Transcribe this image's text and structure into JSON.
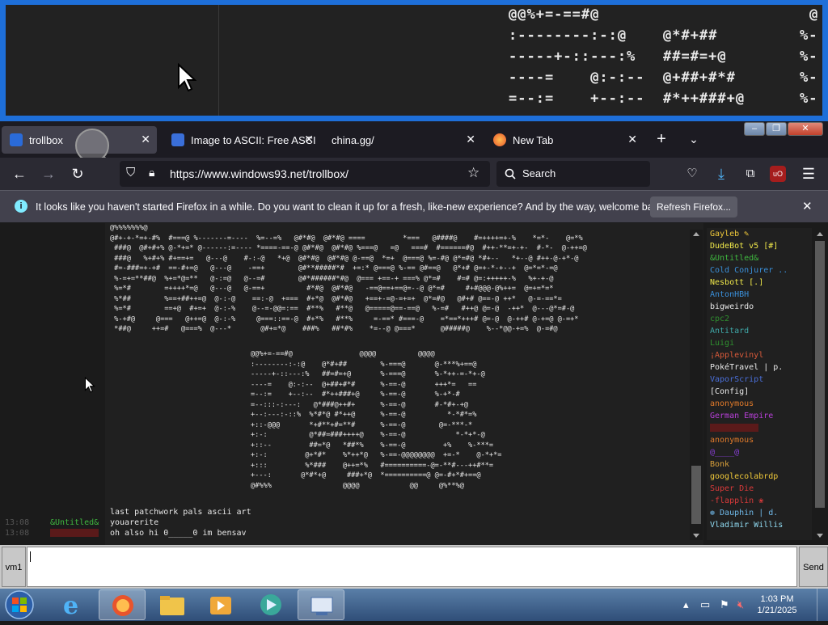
{
  "zoom": {
    "lines": [
      "@@%+=-==#@",
      ":--------:-:@    @*#+##",
      "-----+-::---:%   ##=#=+@",
      "----=    @:-:--  @+##+#*#",
      "=--:=    +--:--  #*++###+@"
    ],
    "right_lines": [
      "@",
      "%-",
      "%-",
      "%-",
      "%-"
    ]
  },
  "tabs": [
    {
      "label": "trollbox",
      "active": true
    },
    {
      "label": "Image to ASCII: Free ASCI",
      "active": false
    },
    {
      "label": "china.gg/",
      "active": false
    },
    {
      "label": "New Tab",
      "active": false
    }
  ],
  "nav": {
    "url": "https://www.windows93.net/trollbox/",
    "search_placeholder": "Search"
  },
  "notification": {
    "text": "It looks like you haven't started Firefox in a while. Do you want to clean it up for a fresh, like-new experience? And by the way, welcome back!",
    "button": "Refresh Firefox..."
  },
  "ascii_art": {
    "top_block": [
      "@%%%%%%%@",
      "@#+-+-*=+-#%  #===@ %-------=----  %=--=%   @#*#@  @#*#@ ====         *===   @####@    #=++++=+-%    *=*-    @=*%",
      " ###@  @#+#+% @-*+=* @------:=---- *====-==-@ @#*#@  @#*#@ %===@   =@   ===#  #======#@  #++-**=+-+-  #-*-  @-++=@",
      " ###@   %+#+% #+==+=   @---@    #-:-@   *+@  @#*#@  @#*#@ @-==@  *=+  @===@ %=-#@ @*=#@ *#+--   *+--@ #++-@-+*-@",
      " #=-###=+-+#  ==-#+=@   @---@    -==+        @#**#####*#  +=:* @===@ %-== @#==@   @*+# @=+-*-+--+  @=*=*-=@",
      " %-=+=**##@  %+=*@=**   @-:=@   @--=#        @#*######*#@  @=== +==-+ ===% @*=#    #=# @=:+++++-%   %+-+-@",
      " %=*#        =++++*=@   @---@   @-==+          #*#@  @#*#@   -==@==+==@=--@ @*=#     #+#@@@-@%++=  @=+=*=*",
      " %*##        %==+##++=@  @-:-@    ==:-@  +===  #+*@  @#*#@   +==+-=@-=+=+  @*=#@   @#+# @==-@ ++*   @-=-==*=",
      " %=*#        ==+@  #+=+  @-:-%    @--=-@@=:==  #**%   #**@   @=====@==-==@   %-=#   #++@ @=-@  -++*  @---@*=#-@",
      " %-+#@     @===   @++=@  @-:-%     @===::==-@  #+*%   #**%     =-==* #===-@    =*==*+++# @=-@  @-++# @-+=@ @-=+*",
      " *##@     ++=#   @===%  @---*       @#+=*@    ###%   ##*#%    *=--@ @===*      @#####@    %--*@@-+=%  @-=#@"
    ],
    "mid_block": [
      "@@%+=-==#@                @@@@          @@@@",
      ":--------:-:@    @*#+##        %-===@       @-***%+==@",
      "-----+-::---:%   ##=#=+@       %-===@       %-*++-=-*+-@",
      "----=    @:-:--  @+##+#*#      %-==-@       +++*=   ==",
      "=--:=    +--:--  #*++###+@     %-==-@       %-+*-#",
      "=--:::-:---:   @*###@++#+      %-==-@       #-*#+-+@",
      "+--:---:-::%  %*#*@ #*++@      %-==-@          *-*#*=%",
      "+::-@@@       *+#**+#=**#      %-==-@        @=-***-*",
      "+:-:          @*##=###++++@    %-==-@            *-*+*-@",
      "+::--         ##=*@   *##*%    %-==-@         +%    %-***=",
      "+:-:         @+*#*    %*++*@   %-==-@@@@@@@@  +=-*    @-*+*=",
      "+:::         %*###    @++=*%   #==========-@=-**#---++#**=",
      "+---:       @*#*+@     ###+*@  *==========@ @=-#+*#+==@",
      "@#%%%                 @@@@            @@     @%**%@"
    ]
  },
  "messages": [
    {
      "time": "",
      "user": "",
      "text": "last patchwork pals ascii art"
    },
    {
      "time": "13:08",
      "user": "&Untitled&",
      "text": "youarerite"
    },
    {
      "time": "13:08",
      "user": "",
      "text": "oh also hi 0_____0 im bensav"
    }
  ],
  "users": [
    {
      "name": "Gayleb ✎",
      "color": "#f0c93a"
    },
    {
      "name": "DudeBot v5 [#]",
      "color": "#f0e84a"
    },
    {
      "name": "&Untitled&",
      "color": "#3fb83f"
    },
    {
      "name": "Cold Conjurer ..",
      "color": "#3a8fd9"
    },
    {
      "name": "Nesbott [.]",
      "color": "#f0e84a"
    },
    {
      "name": "AntonHBH",
      "color": "#3a8fd9"
    },
    {
      "name": "bigweirdo",
      "color": "#e8e8e8"
    },
    {
      "name": "cpc2",
      "color": "#2f8f2f"
    },
    {
      "name": "Antitard",
      "color": "#3fa8a8"
    },
    {
      "name": "Luigi",
      "color": "#2f8f2f"
    },
    {
      "name": "¡Applevinyl",
      "color": "#d95a3a"
    },
    {
      "name": "PokéTravel | p.",
      "color": "#e8e8e8"
    },
    {
      "name": "VaporScript",
      "color": "#4a6fd9"
    },
    {
      "name": "[Config]",
      "color": "#e8e8e8"
    },
    {
      "name": "anonymous",
      "color": "#e07a2a"
    },
    {
      "name": "German Empire",
      "color": "#b83fd9"
    },
    {
      "name": "",
      "color": "#c02020"
    },
    {
      "name": "anonymous",
      "color": "#e07a2a"
    },
    {
      "name": "@____@",
      "color": "#8a3fd9"
    },
    {
      "name": "Bonk",
      "color": "#d9a03a"
    },
    {
      "name": "googlecolabrdp",
      "color": "#f0c93a"
    },
    {
      "name": "Super Die",
      "color": "#d93a3a"
    },
    {
      "name": "-flapplin ❀",
      "color": "#d93a3a"
    },
    {
      "name": "❁ Dauphin | d.",
      "color": "#6fb8e8"
    },
    {
      "name": "Vladimir Willis",
      "color": "#8fd9f0"
    }
  ],
  "input": {
    "channel_button": "vm1",
    "send_button": "Send"
  },
  "taskbar": {
    "time": "1:03 PM",
    "date": "1/21/2025"
  }
}
